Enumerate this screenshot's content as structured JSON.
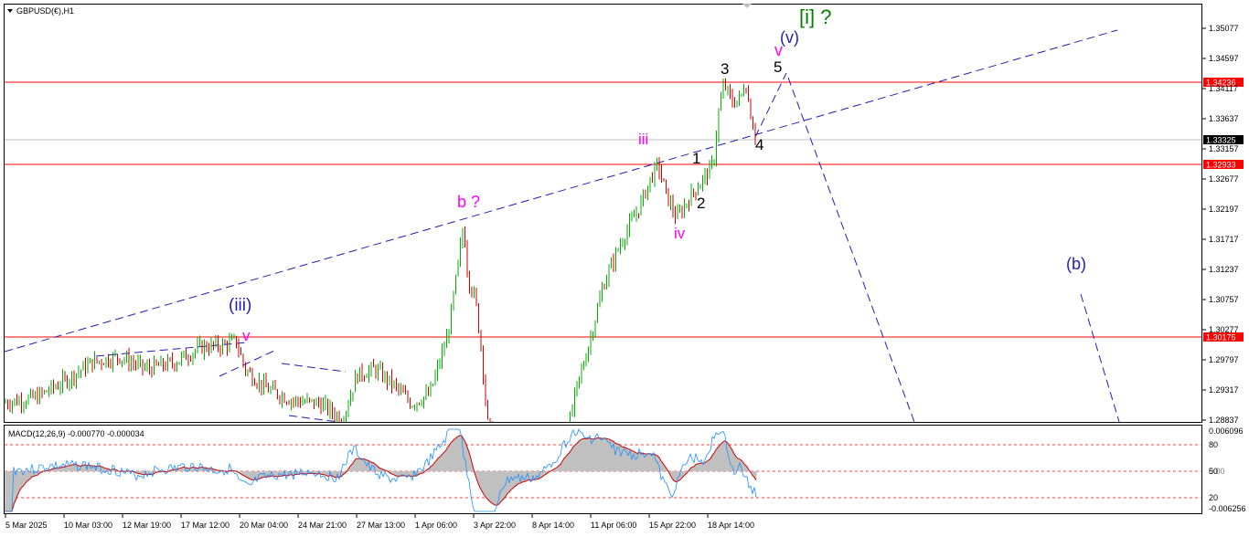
{
  "chart_data": {
    "type": "candlestick",
    "title": "GBPUSD(€),H1",
    "price_axis": {
      "ylim": [
        1.28837,
        1.35287
      ],
      "ticks": [
        "1.35077",
        "1.34597",
        "1.34117",
        "1.33637",
        "1.33157",
        "1.32677",
        "1.32197",
        "1.31717",
        "1.31237",
        "1.30757",
        "1.30277",
        "1.29797",
        "1.29317",
        "1.28837"
      ]
    },
    "time_axis": {
      "ticks": [
        "5 Mar 2025",
        "10 Mar 03:00",
        "12 Mar 19:00",
        "17 Mar 12:00",
        "20 Mar 04:00",
        "24 Mar 21:00",
        "27 Mar 13:00",
        "1 Apr 06:00",
        "3 Apr 22:00",
        "8 Apr 14:00",
        "11 Apr 06:00",
        "15 Apr 22:00",
        "18 Apr 14:00"
      ]
    },
    "price_path": [
      [
        0,
        1.291
      ],
      [
        40,
        1.292
      ],
      [
        70,
        1.2945
      ],
      [
        100,
        1.2975
      ],
      [
        130,
        1.2985
      ],
      [
        160,
        1.2965
      ],
      [
        190,
        1.2975
      ],
      [
        220,
        1.3
      ],
      [
        245,
        1.3003
      ],
      [
        258,
        1.301
      ],
      [
        268,
        1.2965
      ],
      [
        290,
        1.2935
      ],
      [
        320,
        1.2915
      ],
      [
        350,
        1.291
      ],
      [
        375,
        1.2885
      ],
      [
        390,
        1.2955
      ],
      [
        410,
        1.2965
      ],
      [
        430,
        1.294
      ],
      [
        450,
        1.291
      ],
      [
        470,
        1.2925
      ],
      [
        490,
        1.302
      ],
      [
        500,
        1.312
      ],
      [
        507,
        1.3195
      ],
      [
        512,
        1.311
      ],
      [
        520,
        1.3075
      ],
      [
        527,
        1.299
      ],
      [
        533,
        1.288
      ],
      [
        545,
        1.2825
      ],
      [
        560,
        1.281
      ],
      [
        575,
        1.279
      ],
      [
        595,
        1.277
      ],
      [
        615,
        1.282
      ],
      [
        630,
        1.293
      ],
      [
        645,
        1.301
      ],
      [
        660,
        1.31
      ],
      [
        680,
        1.317
      ],
      [
        700,
        1.3225
      ],
      [
        712,
        1.327
      ],
      [
        720,
        1.329
      ],
      [
        728,
        1.3245
      ],
      [
        740,
        1.3205
      ],
      [
        755,
        1.324
      ],
      [
        770,
        1.327
      ],
      [
        780,
        1.329
      ],
      [
        786,
        1.3375
      ],
      [
        792,
        1.342
      ],
      [
        800,
        1.339
      ],
      [
        810,
        1.3395
      ],
      [
        815,
        1.3425
      ],
      [
        820,
        1.338
      ],
      [
        826,
        1.3335
      ]
    ],
    "horizontal_levels": [
      {
        "label": "1.34236",
        "value": 1.34236,
        "color": "#ff0000"
      },
      {
        "label": "1.32933",
        "value": 1.32933,
        "color": "#ff0000"
      },
      {
        "label": "1.30175",
        "value": 1.30175,
        "color": "#ff0000"
      },
      {
        "label": "1.33325",
        "value": 1.33325,
        "color": "#c0c0c0",
        "current": true
      }
    ],
    "wave_labels": [
      {
        "text": "[i] ?",
        "color": "#008000"
      },
      {
        "text": "(v)",
        "color": "#1f1fb4"
      },
      {
        "text": "v",
        "color": "#ff00ff"
      },
      {
        "text": "3",
        "color": "#000000"
      },
      {
        "text": "5",
        "color": "#000000"
      },
      {
        "text": "4",
        "color": "#000000"
      },
      {
        "text": "iii",
        "color": "#ff00ff"
      },
      {
        "text": "1",
        "color": "#000000"
      },
      {
        "text": "2",
        "color": "#000000"
      },
      {
        "text": "iv",
        "color": "#ff00ff"
      },
      {
        "text": "b ?",
        "color": "#ff00ff"
      },
      {
        "text": "(b)",
        "color": "#1f1fb4"
      },
      {
        "text": "(iii)",
        "color": "#1f1fb4"
      },
      {
        "text": "v",
        "color": "#ff00ff"
      }
    ],
    "macd": {
      "title": "MACD(12,26,9) -0.000770 -0.000034",
      "ticks": [
        "0.006096",
        "80",
        "0.00",
        "50",
        "20",
        "-0.006256"
      ],
      "levels": [
        80,
        50,
        20
      ]
    },
    "colors": {
      "bull": "#00b000",
      "bear": "#d00000",
      "trend": "#1f1fb4",
      "macd_line": "#1e90ff",
      "signal": "#d00000",
      "hist": "#c0c0c0",
      "level": "#ff0000"
    }
  }
}
